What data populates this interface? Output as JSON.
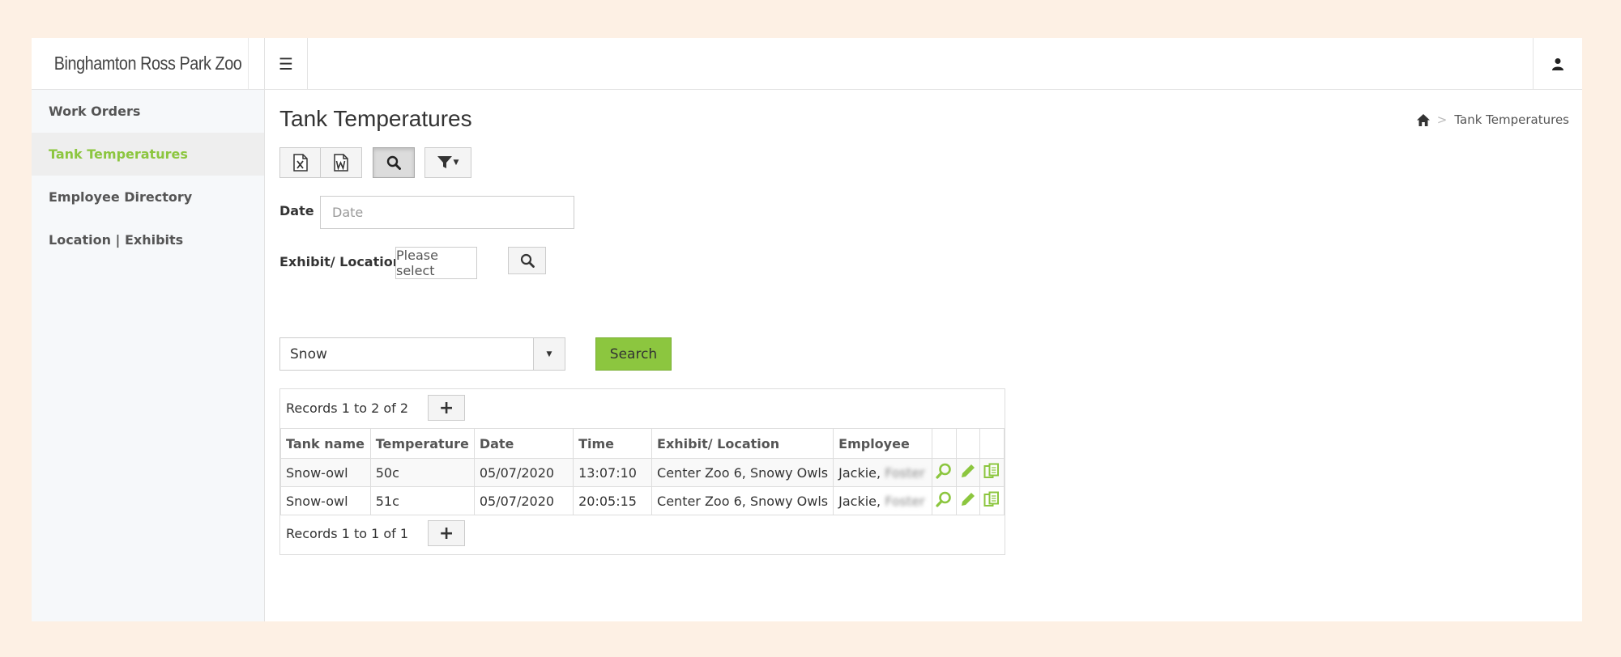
{
  "app": {
    "brand": "Binghamton Ross Park Zoo"
  },
  "sidebar": {
    "items": [
      {
        "label": "Work Orders"
      },
      {
        "label": "Tank Temperatures"
      },
      {
        "label": "Employee Directory"
      },
      {
        "label": "Location | Exhibits"
      }
    ],
    "active_index": 1
  },
  "page": {
    "title": "Tank Temperatures",
    "breadcrumb_current": "Tank Temperatures"
  },
  "filters": {
    "date_label": "Date",
    "date_placeholder": "Date",
    "location_label": "Exhibit/ Location",
    "location_select": "Please select",
    "search_value": "Snow",
    "search_button": "Search"
  },
  "table": {
    "records_top": "Records 1 to 2 of 2",
    "records_bottom": "Records 1 to 1 of 1",
    "columns": [
      "Tank name",
      "Temperature",
      "Date",
      "Time",
      "Exhibit/ Location",
      "Employee"
    ],
    "rows": [
      {
        "tank": "Snow-owl",
        "temp": "50c",
        "date": "05/07/2020",
        "time": "13:07:10",
        "location": "Center Zoo 6, Snowy Owls",
        "employee_first": "Jackie,",
        "employee_last": "Foster"
      },
      {
        "tank": "Snow-owl",
        "temp": "51c",
        "date": "05/07/2020",
        "time": "20:05:15",
        "location": "Center Zoo 6, Snowy Owls",
        "employee_first": "Jackie,",
        "employee_last": "Foster"
      }
    ]
  },
  "colors": {
    "accent": "#8cc63f",
    "background": "#fdf0e4"
  }
}
